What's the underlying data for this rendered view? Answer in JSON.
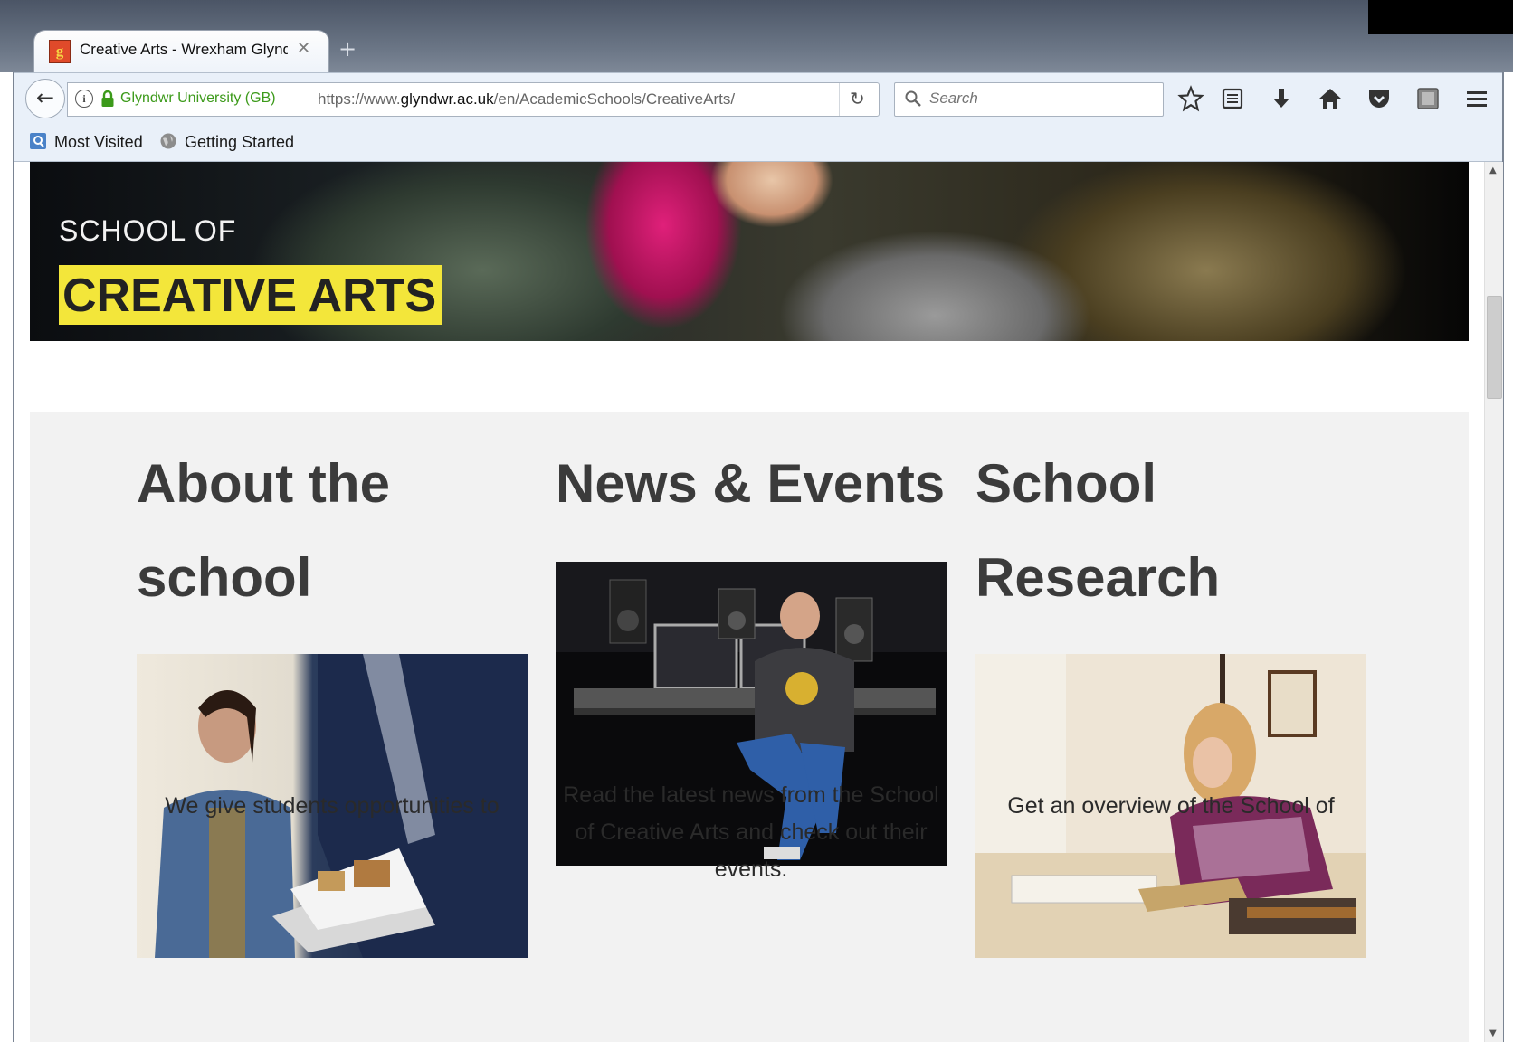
{
  "browser": {
    "tab_title": "Creative Arts - Wrexham Glyndwr University",
    "identity_label": "Glyndwr University (GB)",
    "url_prefix": "https://www.",
    "url_domain": "glyndwr.ac.uk",
    "url_path": "/en/AcademicSchools/CreativeArts/",
    "search_placeholder": "Search",
    "bookmarks": [
      "Most Visited",
      "Getting Started"
    ]
  },
  "hero": {
    "kicker": "SCHOOL OF",
    "title": "CREATIVE ARTS"
  },
  "columns": [
    {
      "heading": "About the school",
      "text": "We give students opportunities to"
    },
    {
      "heading": "News & Events",
      "text": "Read the latest news from the School of Creative Arts and check out their events."
    },
    {
      "heading": "School Research",
      "text": "Get an overview of the School of"
    }
  ],
  "colors": {
    "hero_highlight": "#f3e63a",
    "section_bg": "#f2f2f2",
    "heading": "#3b3b3b",
    "identity_green": "#3c9a1a"
  }
}
